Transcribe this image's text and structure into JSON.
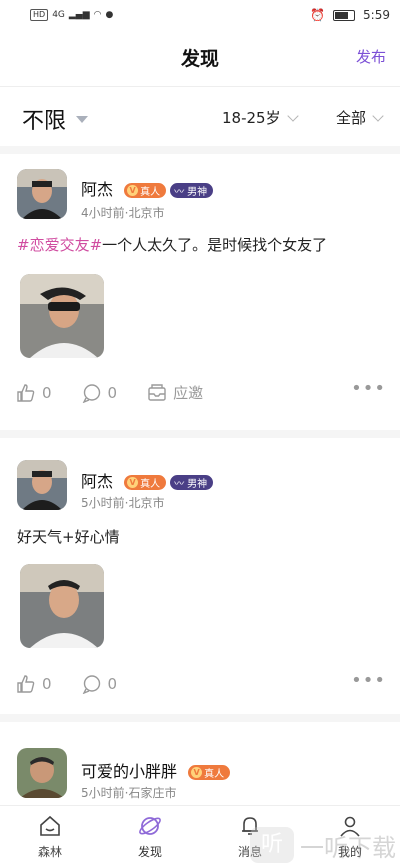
{
  "status_bar": {
    "network": "HD",
    "signal_label": "4G",
    "time": "5:59"
  },
  "header": {
    "title": "发现",
    "publish_label": "发布"
  },
  "filters": {
    "main": "不限",
    "age": "18-25岁",
    "all": "全部"
  },
  "posts": [
    {
      "name": "阿杰",
      "badge_real": "真人",
      "badge_god": "男神",
      "meta": "4小时前·北京市",
      "hashtag": "#恋爱交友#",
      "content": "一个人太久了。是时候找个女友了",
      "likes": "0",
      "comments": "0",
      "invite": "应邀"
    },
    {
      "name": "阿杰",
      "badge_real": "真人",
      "badge_god": "男神",
      "meta": "5小时前·北京市",
      "content": "好天气+好心情",
      "likes": "0",
      "comments": "0"
    },
    {
      "name": "可爱的小胖胖",
      "badge_real": "真人",
      "meta": "5小时前·石家庄市"
    }
  ],
  "more_icon": "•••",
  "bottom_nav": [
    {
      "label": "森林",
      "icon": "home-icon"
    },
    {
      "label": "发现",
      "icon": "planet-icon"
    },
    {
      "label": "消息",
      "icon": "bell-icon"
    },
    {
      "label": "我的",
      "icon": "user-icon"
    }
  ],
  "watermark": {
    "badge": "听",
    "text": "一听下载"
  },
  "colors": {
    "accent": "#7b4fd6",
    "hashtag": "#d04ca0",
    "badge_real": "#ef7a3d",
    "badge_god": "#4a3f86"
  }
}
